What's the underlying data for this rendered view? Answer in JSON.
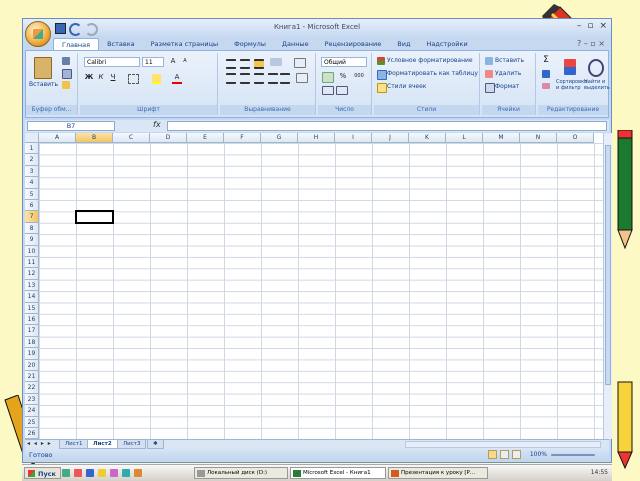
{
  "window": {
    "title": "Книга1 - Microsoft Excel",
    "controls": [
      "–",
      "▫",
      "×"
    ]
  },
  "ribbon": {
    "tabs": [
      "Главная",
      "Вставка",
      "Разметка страницы",
      "Формулы",
      "Данные",
      "Рецензирование",
      "Вид",
      "Надстройки"
    ],
    "active_tab": "Главная",
    "clipboard": {
      "label": "Буфер обм...",
      "paste": "Вставить"
    },
    "font": {
      "label": "Шрифт",
      "name": "Calibri",
      "size": "11",
      "bold": "Ж",
      "italic": "К",
      "underline": "Ч"
    },
    "alignment": {
      "label": "Выравнивание"
    },
    "number": {
      "label": "Число",
      "format": "Общий",
      "percent": "%",
      "thousands": "000"
    },
    "styles": {
      "label": "Стили",
      "conditional": "Условное форматирование",
      "as_table": "Форматировать как таблицу",
      "cell_styles": "Стили ячеек"
    },
    "cells": {
      "label": "Ячейки",
      "insert": "Вставить",
      "delete": "Удалить",
      "format": "Формат"
    },
    "editing": {
      "label": "Редактирование",
      "sort": "Сортировка и фильтр",
      "find": "Найти и выделить",
      "sigma": "Σ"
    }
  },
  "formula_bar": {
    "name_box": "B7",
    "fx": "fx",
    "value": ""
  },
  "grid": {
    "columns": [
      "A",
      "B",
      "C",
      "D",
      "E",
      "F",
      "G",
      "H",
      "I",
      "J",
      "K",
      "L",
      "M",
      "N",
      "O"
    ],
    "rows": [
      "1",
      "2",
      "3",
      "4",
      "5",
      "6",
      "7",
      "8",
      "9",
      "10",
      "11",
      "12",
      "13",
      "14",
      "15",
      "16",
      "17",
      "18",
      "19",
      "20",
      "21",
      "22",
      "23",
      "24",
      "25",
      "26"
    ],
    "active_column": "B",
    "active_row": "7"
  },
  "sheets": {
    "tabs": [
      "Лист1",
      "Лист2",
      "Лист3"
    ],
    "active": "Лист2"
  },
  "status": {
    "text": "Готово",
    "zoom": "100%"
  },
  "taskbar": {
    "start": "Пуск",
    "items": [
      "Локальный диск (D:)",
      "Microsoft Excel - Книга1",
      "Презентация к уроку [Р..."
    ],
    "active_item": "Microsoft Excel - Книга1",
    "clock": "14:55"
  },
  "colors": {
    "accent": "#15428b",
    "ribbon": "#d4e3f5",
    "selection": "#f5c463",
    "page_bg": "#fdf9c4"
  }
}
